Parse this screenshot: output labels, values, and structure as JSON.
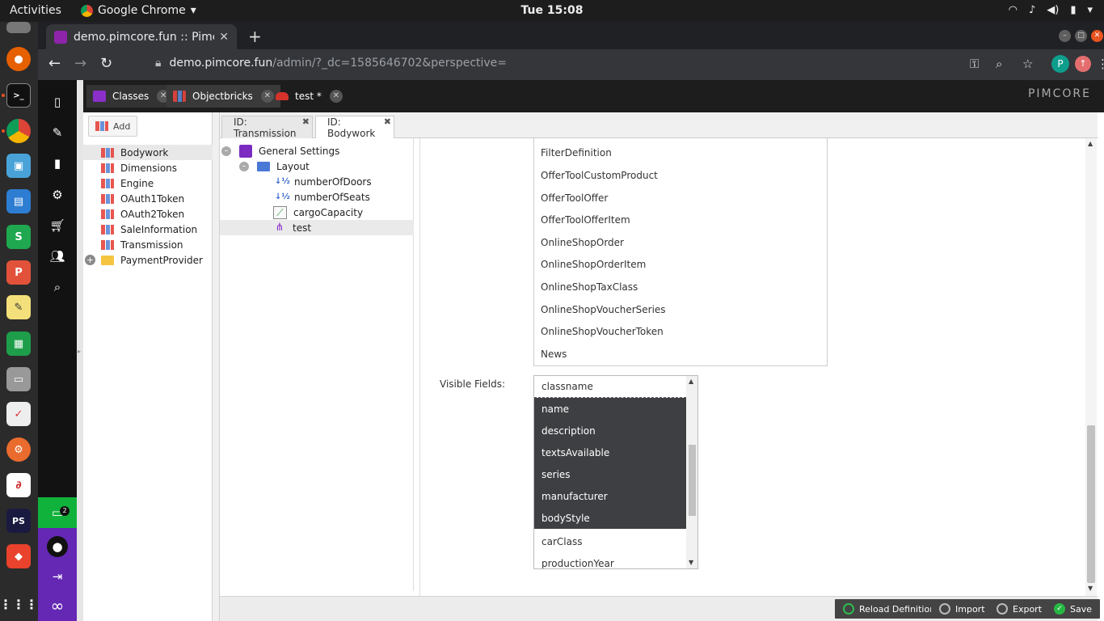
{
  "system": {
    "activities": "Activities",
    "app_name": "Google Chrome",
    "clock": "Tue 15:08"
  },
  "dock": {
    "chat_badge": "2"
  },
  "browser": {
    "tab_title": "demo.pimcore.fun :: Pimc",
    "url_host": "demo.pimcore.fun",
    "url_path": "/admin/?_dc=1585646702&perspective=",
    "profile_initial": "P"
  },
  "pimcore": {
    "logo": "PIMCORE",
    "main_tabs": [
      {
        "label": "Classes"
      },
      {
        "label": "Objectbricks"
      },
      {
        "label": "test *"
      }
    ],
    "left_panel": {
      "add_label": "Add",
      "items": [
        {
          "label": "Bodywork"
        },
        {
          "label": "Dimensions"
        },
        {
          "label": "Engine"
        },
        {
          "label": "OAuth1Token"
        },
        {
          "label": "OAuth2Token"
        },
        {
          "label": "SaleInformation"
        },
        {
          "label": "Transmission"
        },
        {
          "label": "PaymentProvider"
        }
      ]
    },
    "editor_tabs": [
      {
        "label": "ID: Transmission"
      },
      {
        "label": "ID: Bodywork"
      }
    ],
    "layout_tree": {
      "general": "General Settings",
      "layout": "Layout",
      "fields": [
        "numberOfDoors",
        "numberOfSeats",
        "cargoCapacity",
        "test"
      ]
    },
    "class_list": [
      "FilterDefinition",
      "OfferToolCustomProduct",
      "OfferToolOffer",
      "OfferToolOfferItem",
      "OnlineShopOrder",
      "OnlineShopOrderItem",
      "OnlineShopTaxClass",
      "OnlineShopVoucherSeries",
      "OnlineShopVoucherToken",
      "News"
    ],
    "visible_fields_label": "Visible Fields:",
    "visible_fields": [
      {
        "label": "classname",
        "selected": false
      },
      {
        "label": "name",
        "selected": true
      },
      {
        "label": "description",
        "selected": true
      },
      {
        "label": "textsAvailable",
        "selected": true
      },
      {
        "label": "series",
        "selected": true
      },
      {
        "label": "manufacturer",
        "selected": true
      },
      {
        "label": "bodyStyle",
        "selected": true
      },
      {
        "label": "carClass",
        "selected": false
      },
      {
        "label": "productionYear",
        "selected": false
      }
    ],
    "footer": {
      "reload": "Reload Definition",
      "import": "Import",
      "export": "Export",
      "save": "Save"
    }
  }
}
